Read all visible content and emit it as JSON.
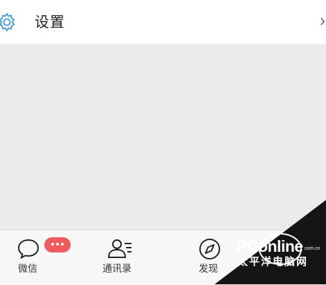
{
  "header": {
    "title": "设置",
    "icon": "gear-icon"
  },
  "tabbar": {
    "tabs": [
      {
        "label": "微信",
        "icon": "chat-bubble-icon",
        "badge": "•••"
      },
      {
        "label": "通讯录",
        "icon": "contacts-icon"
      },
      {
        "label": "发现",
        "icon": "compass-icon"
      }
    ]
  },
  "watermark": {
    "brand": "PConline",
    "domain": "com.cn",
    "subtitle": "太平洋电脑网"
  },
  "colors": {
    "accent_icon": "#4a9fd6",
    "badge": "#f05a5a",
    "header_bg": "#ffffff",
    "content_bg": "#ebebeb",
    "tabbar_bg": "#f7f7f7"
  }
}
